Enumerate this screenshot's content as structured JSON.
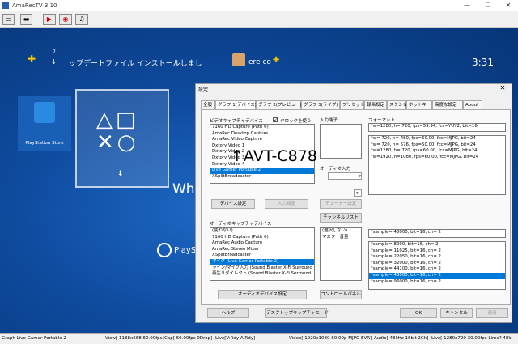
{
  "window": {
    "title": "AmaRecTV 3.10"
  },
  "ps": {
    "notif_count": "7",
    "update_text": "ップデートファイル インストールしまし",
    "username": "ere co",
    "clock": "3:31",
    "store_label": "PlayStation Store",
    "partial_text": "Wh",
    "partial_text2": "PlayS"
  },
  "overlay_label": "↑AVT-C878",
  "dialog": {
    "title": "設定",
    "tabs": [
      "全般",
      "グラフ 1(デバイス)",
      "グラフ 2(プレビュー)",
      "グラフ 3(ライブ)",
      "プリセット",
      "録画設定",
      "スクショ",
      "ホットキー",
      "高度な設定",
      "About"
    ],
    "video_device_label": "ビデオキャプチャデバイス",
    "use_clock_label": "クロックを使う",
    "video_devices": [
      "7160 HD Capture (Path 0)",
      "AmaRec Desktop Capture",
      "AmaRec Video Capture",
      "Dxtory Video 1",
      "Dxtory Video 2",
      "Dxtory Video 3",
      "Dxtory Video 4",
      "Live Gamer Portable 2",
      "XSplitBroadcaster"
    ],
    "input_terminal_label": "入力端子",
    "format_label": "フォーマット",
    "format_current": "*w=1280, h= 720, fps=59.94, fcc=YUY2, bit=16",
    "formats": [
      "*w= 720, h= 480, fps=60.00, fcc=MJPG, bit=24",
      "*w= 720, h= 576, fps=50.00, fcc=MJPG, bit=24",
      "*w=1280, h= 720, fps=60.00, fcc=MJPG, bit=24",
      "*w=1920, h=1080, fps=60.00, fcc=MJPG, bit=24"
    ],
    "audio_input_label": "オーディオ入力",
    "device_settings_btn": "デバイス設定",
    "input_settings_btn": "入力設定",
    "tuner_settings_btn": "チューナー設定",
    "channel_list_btn": "チャンネルリスト",
    "audio_device_label": "オーディオキャプチャデバイス",
    "audio_devices": [
      "(使わない)",
      "7160 HD Capture (Path 0)",
      "AmaRec Audio Capture",
      "AmaRec Stereo Mixer",
      "XSplitBroadcaster",
      "マイク (Live Gamer Portable 2)",
      "ライン/マイク入力 (Sound Blaster X-Fi Surround",
      "再生リダイレクト (Sound Blaster X-Fi Surround"
    ],
    "audio_inputs": [
      "(選択しない)",
      "マスター音量"
    ],
    "audio_format_current": "*sample= 48000, bit=16, ch= 2",
    "audio_formats": [
      "*sample=  8000, bit=16, ch= 2",
      "*sample= 11025, bit=16, ch= 2",
      "*sample= 22050, bit=16, ch= 2",
      "*sample= 32000, bit=16, ch= 2",
      "*sample= 44100, bit=16, ch= 2",
      "*sample= 48000, bit=16, ch= 2",
      "*sample= 96000, bit=16, ch= 2"
    ],
    "audio_device_settings_btn": "オーディオデバイス設定",
    "control_panel_btn": "コントロールパネル",
    "help_btn": "ヘルプ",
    "desktop_mode_btn": "デスクトップキャプチャモード",
    "ok_btn": "OK",
    "cancel_btn": "キャンセル",
    "apply_btn": "適用"
  },
  "status": {
    "graph": "Graph Live Gamer Portable 2",
    "view": "View[ 1188x668 60.00fps]",
    "cap": "Cap[ 60.00fps 0Drop]",
    "live": "Live[V:Rdy A:Rdy]",
    "video": "Video[ 1920x1080 60.00p MJPG EVR]",
    "audio": "Audio[ 48kHz 16bit 2Ch]",
    "live2": "Live[ 1280x720 30.00fps Lime? 48k"
  }
}
